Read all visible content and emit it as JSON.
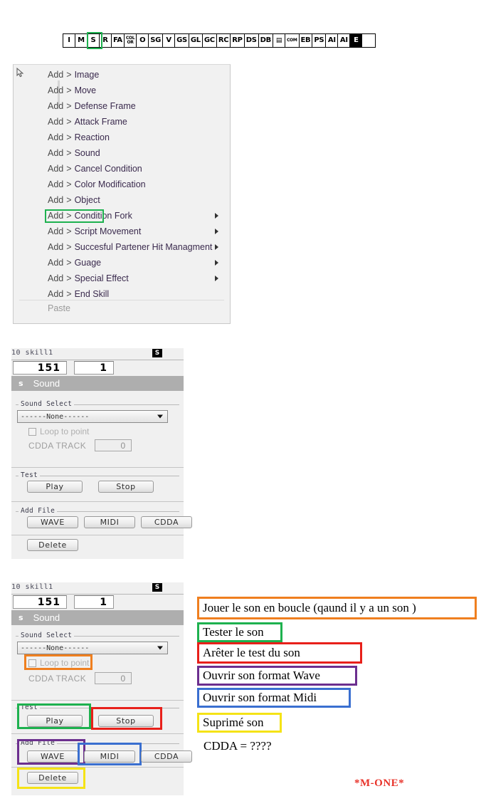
{
  "toolbar": {
    "buttons": [
      {
        "label": "I",
        "style": "plain"
      },
      {
        "label": "M",
        "style": "plain"
      },
      {
        "label": "S",
        "style": "plain"
      },
      {
        "label": "R",
        "style": "plain"
      },
      {
        "label": "FA",
        "style": "plain"
      },
      {
        "label": "COL\nOR",
        "style": "stacked",
        "top": "COL",
        "bottom": "OR"
      },
      {
        "label": "O",
        "style": "plain"
      },
      {
        "label": "SG",
        "style": "plain"
      },
      {
        "label": "V",
        "style": "plain"
      },
      {
        "label": "GS",
        "style": "plain"
      },
      {
        "label": "GL",
        "style": "plain"
      },
      {
        "label": "GC",
        "style": "plain"
      },
      {
        "label": "RC",
        "style": "plain"
      },
      {
        "label": "RP",
        "style": "plain"
      },
      {
        "label": "DS",
        "style": "plain"
      },
      {
        "label": "DB",
        "style": "plain"
      },
      {
        "label": "▤",
        "style": "glyph"
      },
      {
        "label": "COM",
        "style": "small"
      },
      {
        "label": "EB",
        "style": "plain"
      },
      {
        "label": "PS",
        "style": "plain"
      },
      {
        "label": "AI",
        "style": "plain"
      },
      {
        "label": "AI",
        "style": "plain"
      },
      {
        "label": "E",
        "style": "inverted"
      },
      {
        "label": "",
        "style": "blank"
      }
    ],
    "highlight_index": 2,
    "highlight_color": "#1eb14f"
  },
  "context_menu": {
    "cursor_icon": "arrow-cursor-icon",
    "items": [
      {
        "prefix": "Add",
        "sep": ">",
        "label": "Image",
        "submenu": false
      },
      {
        "prefix": "Add",
        "sep": ">",
        "label": "Move",
        "submenu": false
      },
      {
        "prefix": "Add",
        "sep": ">",
        "label": "Defense Frame",
        "submenu": false
      },
      {
        "prefix": "Add",
        "sep": ">",
        "label": "Attack Frame",
        "submenu": false
      },
      {
        "prefix": "Add",
        "sep": ">",
        "label": "Reaction",
        "submenu": false
      },
      {
        "prefix": "Add",
        "sep": ">",
        "label": "Sound",
        "submenu": false
      },
      {
        "prefix": "Add",
        "sep": ">",
        "label": "Cancel Condition",
        "submenu": false
      },
      {
        "prefix": "Add",
        "sep": ">",
        "label": "Color Modification",
        "submenu": false
      },
      {
        "prefix": "Add",
        "sep": ">",
        "label": "Object",
        "submenu": false
      },
      {
        "prefix": "Add",
        "sep": ">",
        "label": "Condition Fork",
        "submenu": true
      },
      {
        "prefix": "Add",
        "sep": ">",
        "label": "Script Movement",
        "submenu": true
      },
      {
        "prefix": "Add",
        "sep": ">",
        "label": "Succesful Partener Hit Managment",
        "submenu": true
      },
      {
        "prefix": "Add",
        "sep": ">",
        "label": "Guage",
        "submenu": true
      },
      {
        "prefix": "Add",
        "sep": ">",
        "label": "Special Effect",
        "submenu": true
      },
      {
        "prefix": "Add",
        "sep": ">",
        "label": "End Skill",
        "submenu": false
      }
    ],
    "paste_label": "Paste",
    "highlighted_item": "Add > Sound",
    "highlight_color": "#1eb14f"
  },
  "sound_panel": {
    "title_text": "10  skill1",
    "title_badge": "S",
    "field_a": "151",
    "field_b": "1",
    "header_icon": "s",
    "header_label": "Sound",
    "sound_select_legend": "Sound Select",
    "sound_select_value": "------None------",
    "loop_checkbox_label": "Loop to point",
    "loop_checked": false,
    "cdda_label": "CDDA TRACK",
    "cdda_value": "0",
    "test_legend": "Test",
    "play_label": "Play",
    "stop_label": "Stop",
    "addfile_legend": "Add File",
    "wave_label": "WAVE",
    "midi_label": "MIDI",
    "cdda_button_label": "CDDA",
    "delete_label": "Delete"
  },
  "annotation_colors": {
    "orange": "#ef7f1f",
    "green": "#1eb14f",
    "red": "#e8201a",
    "purple": "#6c2f8f",
    "blue": "#3a6fd0",
    "yellow": "#f5e316"
  },
  "notes": [
    {
      "text": "Jouer le son en boucle (qaund il y a un son )",
      "color": "#ef7f1f"
    },
    {
      "text": "Tester le son",
      "color": "#1eb14f"
    },
    {
      "text": "Arêter le  test du son",
      "color": "#e8201a"
    },
    {
      "text": "Ouvrir son format Wave",
      "color": "#6c2f8f"
    },
    {
      "text": "Ouvrir son format Midi",
      "color": "#3a6fd0"
    },
    {
      "text": "Suprimé son",
      "color": "#f5e316"
    },
    {
      "text": "CDDA = ????",
      "color": "none"
    }
  ],
  "signature": "*M-ONE*"
}
